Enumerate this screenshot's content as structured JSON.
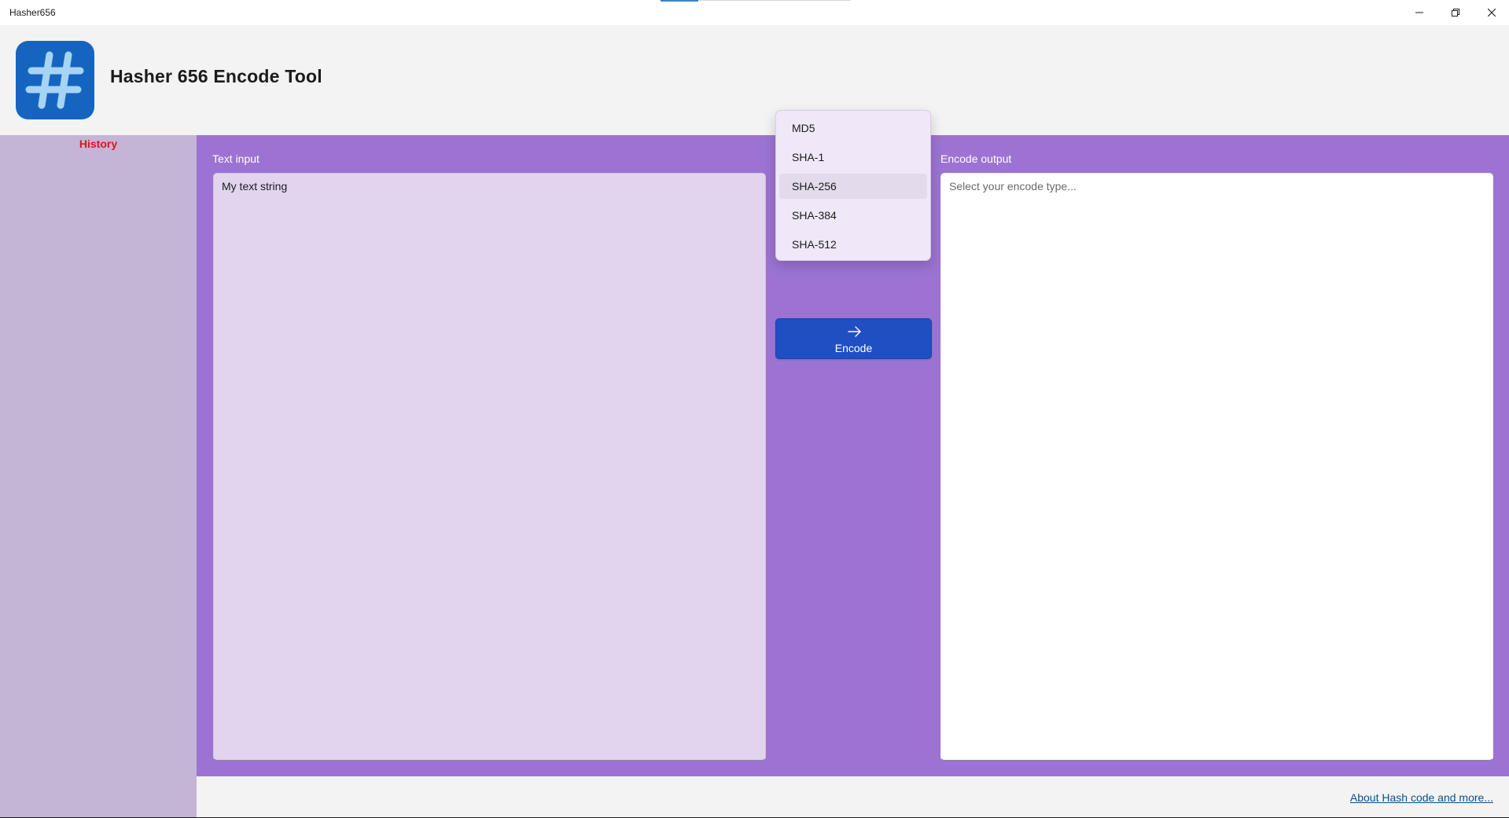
{
  "window": {
    "title": "Hasher656",
    "controls": [
      "minimize-icon",
      "restore-icon",
      "close-icon"
    ]
  },
  "header": {
    "logo_icon": "hash-icon",
    "title": "Hasher 656 Encode Tool"
  },
  "sidebar": {
    "history_label": "History"
  },
  "input": {
    "label": "Text input",
    "value": "My text string"
  },
  "encode_type": {
    "options": [
      {
        "label": "MD5"
      },
      {
        "label": "SHA-1"
      },
      {
        "label": "SHA-256",
        "selected": true
      },
      {
        "label": "SHA-384"
      },
      {
        "label": "SHA-512"
      }
    ]
  },
  "encode_button": {
    "icon": "arrow-right-icon",
    "label": "Encode"
  },
  "output": {
    "label": "Encode output",
    "placeholder": "Select your encode type..."
  },
  "footer": {
    "about_link": "About Hash code and more..."
  },
  "colors": {
    "accent": "#1f4fc2",
    "panel": "#9c73d2",
    "sidebar": "#c4b4d6",
    "history": "#e8101a",
    "logo": "#1565c0"
  }
}
